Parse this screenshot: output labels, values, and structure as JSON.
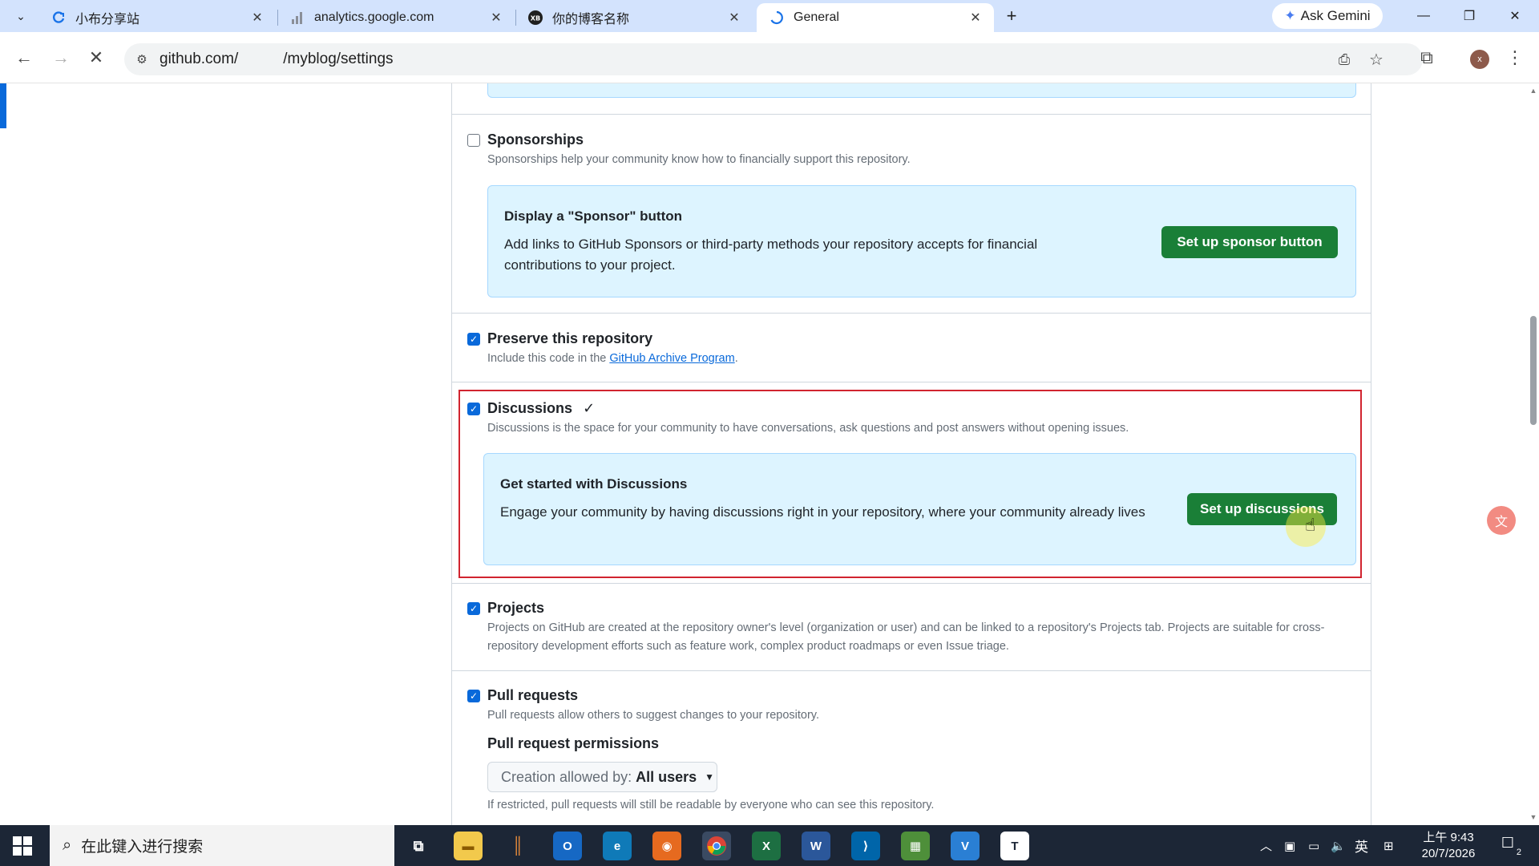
{
  "browser": {
    "tabs": [
      {
        "title": "小布分享站",
        "favicon": "chrome-refresh-icon"
      },
      {
        "title": "analytics.google.com",
        "favicon": "analytics-icon"
      },
      {
        "title": "你的博客名称",
        "favicon": "xb-logo-icon"
      },
      {
        "title": "General",
        "favicon": "loading-spinner-icon",
        "active": true
      }
    ],
    "ask_gemini": "Ask Gemini",
    "url_host": "github.com/",
    "url_path": "/myblog/settings"
  },
  "settings": {
    "sponsorships": {
      "checked": false,
      "title": "Sponsorships",
      "desc": "Sponsorships help your community know how to financially support this repository.",
      "box_title": "Display a \"Sponsor\" button",
      "box_text": "Add links to GitHub Sponsors or third-party methods your repository accepts for financial contributions to your project.",
      "button": "Set up sponsor button"
    },
    "preserve": {
      "checked": true,
      "title": "Preserve this repository",
      "desc_prefix": "Include this code in the ",
      "desc_link": "GitHub Archive Program",
      "desc_suffix": "."
    },
    "discussions": {
      "checked": true,
      "title": "Discussions",
      "check_mark": "✓",
      "desc": "Discussions is the space for your community to have conversations, ask questions and post answers without opening issues.",
      "box_title": "Get started with Discussions",
      "box_text": "Engage your community by having discussions right in your repository, where your community already lives",
      "button": "Set up discussions"
    },
    "projects": {
      "checked": true,
      "title": "Projects",
      "desc": "Projects on GitHub are created at the repository owner's level (organization or user) and can be linked to a repository's Projects tab. Projects are suitable for cross-repository development efforts such as feature work, complex product roadmaps or even Issue triage."
    },
    "pull_requests": {
      "checked": true,
      "title": "Pull requests",
      "desc": "Pull requests allow others to suggest changes to your repository.",
      "permissions_title": "Pull request permissions",
      "select_label": "Creation allowed by:",
      "select_value": "All users",
      "footnote": "If restricted, pull requests will still be readable by everyone who can see this repository."
    }
  },
  "taskbar": {
    "search_placeholder": "在此键入进行搜索",
    "ime": "英",
    "time": "上午 9:43",
    "date": "20/7/2026",
    "notifications": "2"
  },
  "colors": {
    "accent_blue": "#0969da",
    "button_green": "#1a7f37",
    "highlight_red": "#d1242f",
    "info_bg": "#ddf4ff"
  }
}
